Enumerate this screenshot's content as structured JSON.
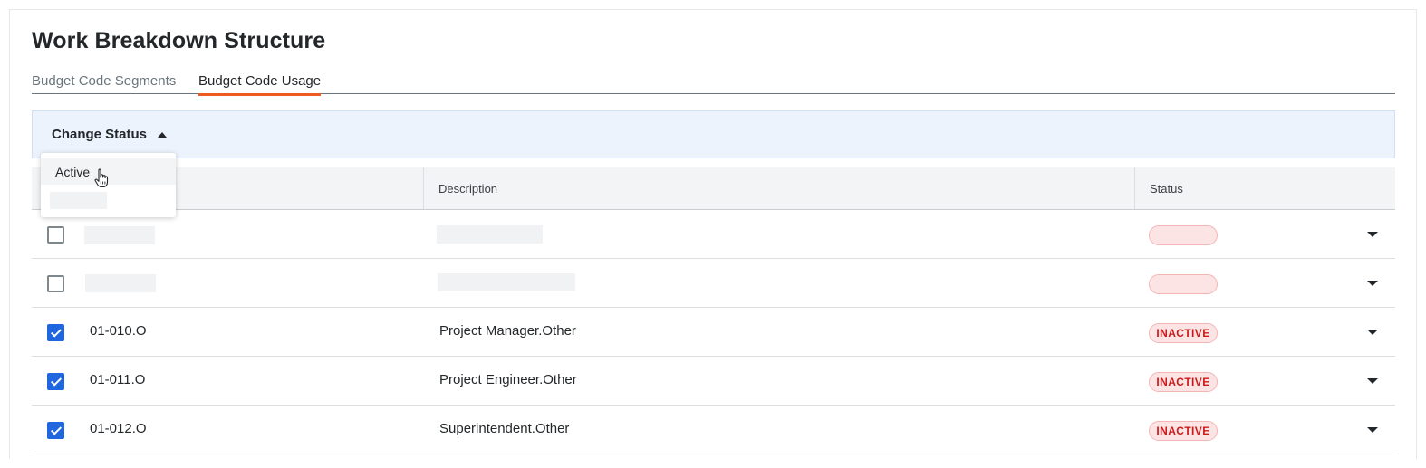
{
  "page": {
    "title": "Work Breakdown Structure"
  },
  "tabs": [
    {
      "label": "Budget Code Segments",
      "active": false
    },
    {
      "label": "Budget Code Usage",
      "active": true
    }
  ],
  "action_bar": {
    "change_status_label": "Change Status"
  },
  "status_dropdown": {
    "options": [
      "Active"
    ]
  },
  "table": {
    "columns": [
      "",
      "Description",
      "Status"
    ],
    "rows": [
      {
        "checked": false,
        "code": "",
        "description": "",
        "status": ""
      },
      {
        "checked": false,
        "code": "",
        "description": "",
        "status": ""
      },
      {
        "checked": true,
        "code": "01-010.O",
        "description": "Project Manager.Other",
        "status": "INACTIVE"
      },
      {
        "checked": true,
        "code": "01-011.O",
        "description": "Project Engineer.Other",
        "status": "INACTIVE"
      },
      {
        "checked": true,
        "code": "01-012.O",
        "description": "Superintendent.Other",
        "status": "INACTIVE"
      }
    ]
  },
  "colors": {
    "accent_tab": "#ee5a1f",
    "checkbox": "#2066df",
    "inactive_text": "#c91b1b",
    "inactive_bg": "#fde4e4"
  },
  "icons": {
    "sort_caret": "caret-up-icon",
    "row_expand": "caret-down-icon",
    "cursor": "hand-pointer-icon"
  }
}
